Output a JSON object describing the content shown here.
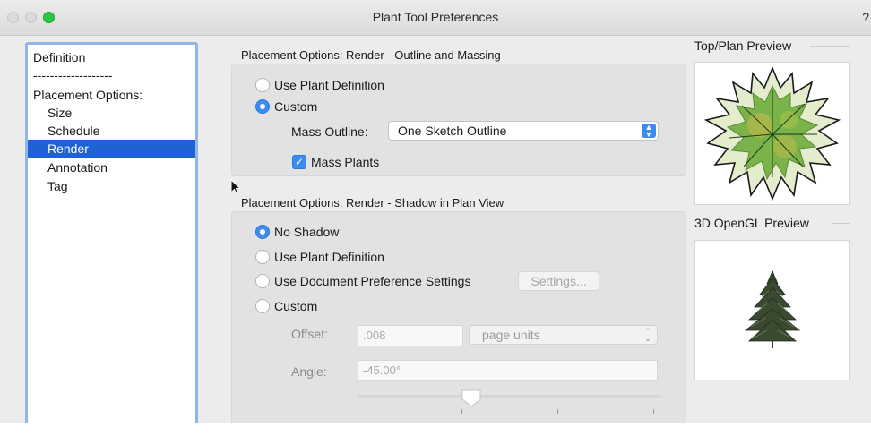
{
  "window": {
    "title": "Plant Tool Preferences",
    "help": "?"
  },
  "sidebar": {
    "items": [
      {
        "label": "Definition"
      },
      {
        "label": "-------------------"
      },
      {
        "label": "Placement Options:"
      },
      {
        "label": "Size"
      },
      {
        "label": "Schedule"
      },
      {
        "label": "Render",
        "selected": true
      },
      {
        "label": "Annotation"
      },
      {
        "label": "Tag"
      }
    ]
  },
  "outline_section": {
    "title": "Placement Options: Render - Outline and Massing",
    "use_plant_definition": "Use Plant Definition",
    "custom": "Custom",
    "selected": "custom",
    "mass_outline_label": "Mass Outline:",
    "mass_outline_value": "One Sketch Outline",
    "mass_plants_label": "Mass Plants",
    "mass_plants_checked": true
  },
  "shadow_section": {
    "title": "Placement Options: Render - Shadow in Plan View",
    "no_shadow": "No Shadow",
    "use_plant_definition": "Use Plant Definition",
    "use_document_pref": "Use Document Preference Settings",
    "settings_button": "Settings...",
    "custom": "Custom",
    "selected": "no_shadow",
    "offset_label": "Offset:",
    "offset_value": ".008",
    "offset_units": "page units",
    "angle_label": "Angle:",
    "angle_value": "-45.00°"
  },
  "previews": {
    "top_plan": "Top/Plan Preview",
    "opengl": "3D OpenGL Preview"
  },
  "colors": {
    "accent": "#3d8cf2",
    "selection": "#1f62d6",
    "sidebar_border": "#8fb6ea"
  }
}
